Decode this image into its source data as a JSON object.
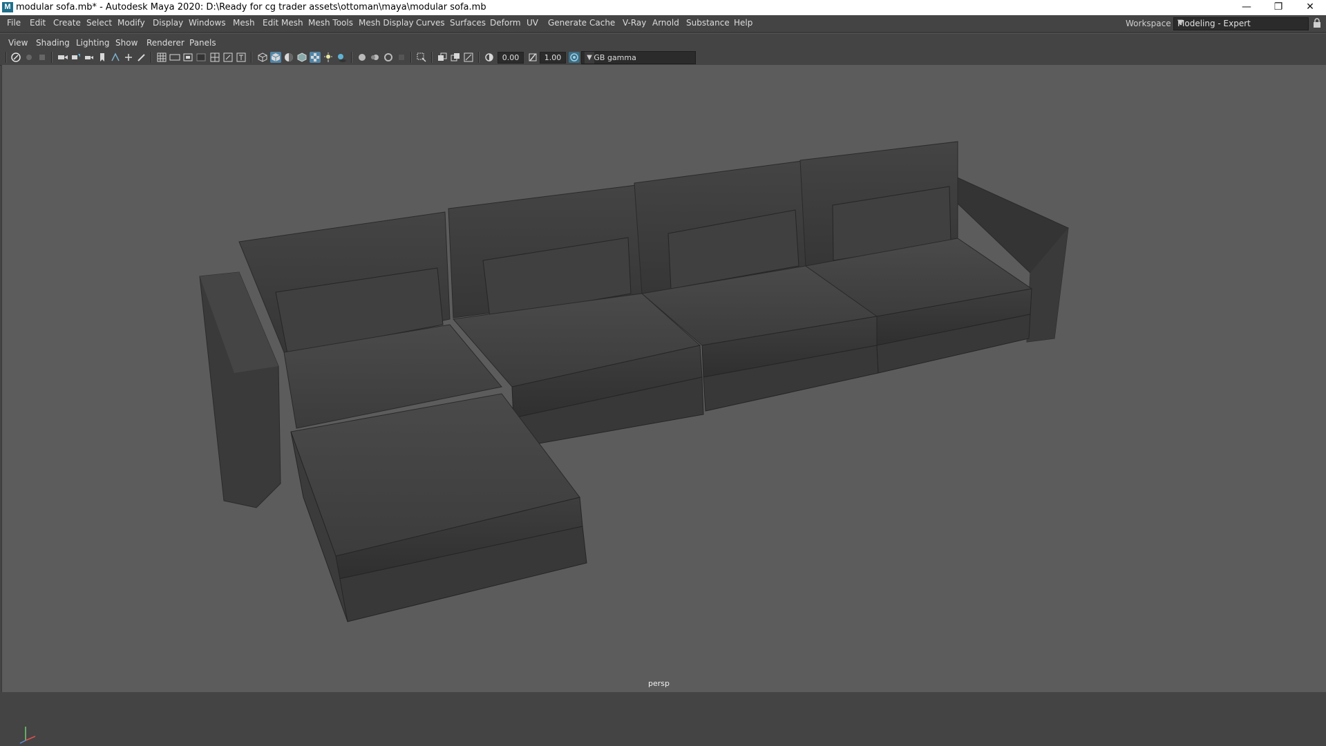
{
  "window": {
    "title": "modular sofa.mb* - Autodesk Maya 2020: D:\\Ready for cg trader assets\\ottoman\\maya\\modular sofa.mb",
    "app_icon": "M",
    "controls": {
      "minimize": "—",
      "restore": "❐",
      "close": "✕"
    }
  },
  "menubar": {
    "items": [
      "File",
      "Edit",
      "Create",
      "Select",
      "Modify",
      "Display",
      "Windows",
      "Mesh",
      "Edit Mesh",
      "Mesh Tools",
      "Mesh Display",
      "Curves",
      "Surfaces",
      "Deform",
      "UV",
      "Generate",
      "Cache",
      "V-Ray",
      "Arnold",
      "Substance",
      "Help"
    ],
    "workspace_label": "Workspace :",
    "workspace_value": "Modeling - Expert"
  },
  "panel_menu": {
    "items": [
      "View",
      "Shading",
      "Lighting",
      "Show",
      "Renderer",
      "Panels"
    ]
  },
  "toolbar": {
    "exposure": "0.00",
    "gamma": "1.00",
    "color_space": "sRGB gamma"
  },
  "viewport": {
    "camera": "persp",
    "background_color": "#5c5c5c"
  }
}
